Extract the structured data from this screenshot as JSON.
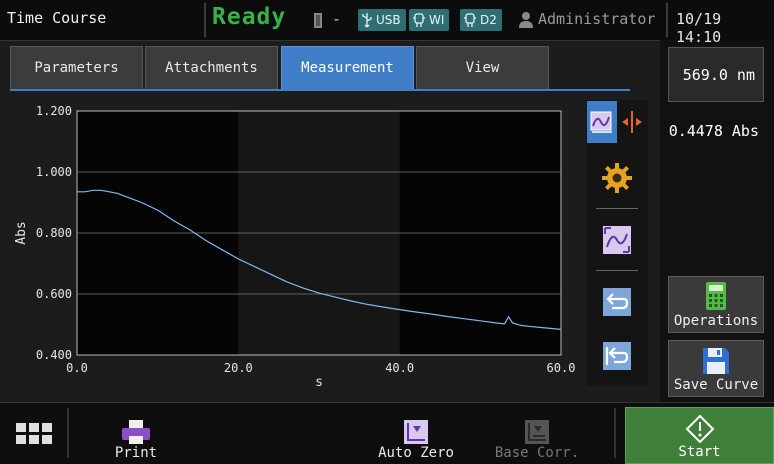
{
  "header": {
    "title": "Time Course",
    "status": "Ready",
    "lamp_dash": "-",
    "chips": [
      {
        "label": "USB",
        "icon": "usb-icon"
      },
      {
        "label": "WI",
        "icon": "lamp-icon"
      },
      {
        "label": "D2",
        "icon": "lamp-icon"
      }
    ],
    "user": "Administrator",
    "datetime": "10/19 14:10"
  },
  "tabs": [
    {
      "label": "Parameters",
      "active": false
    },
    {
      "label": "Attachments",
      "active": false
    },
    {
      "label": "Measurement",
      "active": true
    },
    {
      "label": "View",
      "active": false
    }
  ],
  "readouts": {
    "wavelength": "569.0 nm",
    "absorbance": "0.4478 Abs"
  },
  "side_buttons": {
    "operations": "Operations",
    "save_curve": "Save Curve"
  },
  "toolbar": {
    "icons": [
      "trace-select-icon",
      "cursor-icon",
      "gear-icon",
      "auto-scale-icon",
      "undo-icon",
      "undo-all-icon"
    ]
  },
  "bottom": {
    "print": "Print",
    "auto_zero": "Auto Zero",
    "base_corr": "Base Corr.",
    "start": "Start"
  },
  "colors": {
    "accent": "#3f7ec7",
    "status_green": "#36b24a",
    "trace": "#7fb8f0",
    "start_green": "#3f7f3a"
  },
  "chart_data": {
    "type": "line",
    "xlabel": "s",
    "ylabel": "Abs",
    "xlim": [
      0,
      60
    ],
    "ylim": [
      0.4,
      1.2
    ],
    "xticks": [
      "0.0",
      "20.0",
      "40.0",
      "60.0"
    ],
    "yticks": [
      "0.400",
      "0.600",
      "0.800",
      "1.000",
      "1.200"
    ],
    "grid": true,
    "series": [
      {
        "x": [
          0,
          1,
          2,
          3,
          4,
          5,
          6,
          8,
          10,
          12,
          14,
          16,
          18,
          20,
          22,
          24,
          26,
          28,
          30,
          32,
          34,
          36,
          38,
          40,
          42,
          44,
          46,
          48,
          50,
          52,
          53,
          53.5,
          54,
          55,
          56,
          58,
          60
        ],
        "y": [
          0.935,
          0.935,
          0.94,
          0.94,
          0.935,
          0.93,
          0.92,
          0.9,
          0.875,
          0.84,
          0.81,
          0.775,
          0.745,
          0.715,
          0.69,
          0.665,
          0.64,
          0.62,
          0.603,
          0.59,
          0.577,
          0.566,
          0.557,
          0.549,
          0.541,
          0.534,
          0.526,
          0.519,
          0.512,
          0.505,
          0.502,
          0.525,
          0.505,
          0.497,
          0.494,
          0.489,
          0.484
        ]
      }
    ]
  }
}
